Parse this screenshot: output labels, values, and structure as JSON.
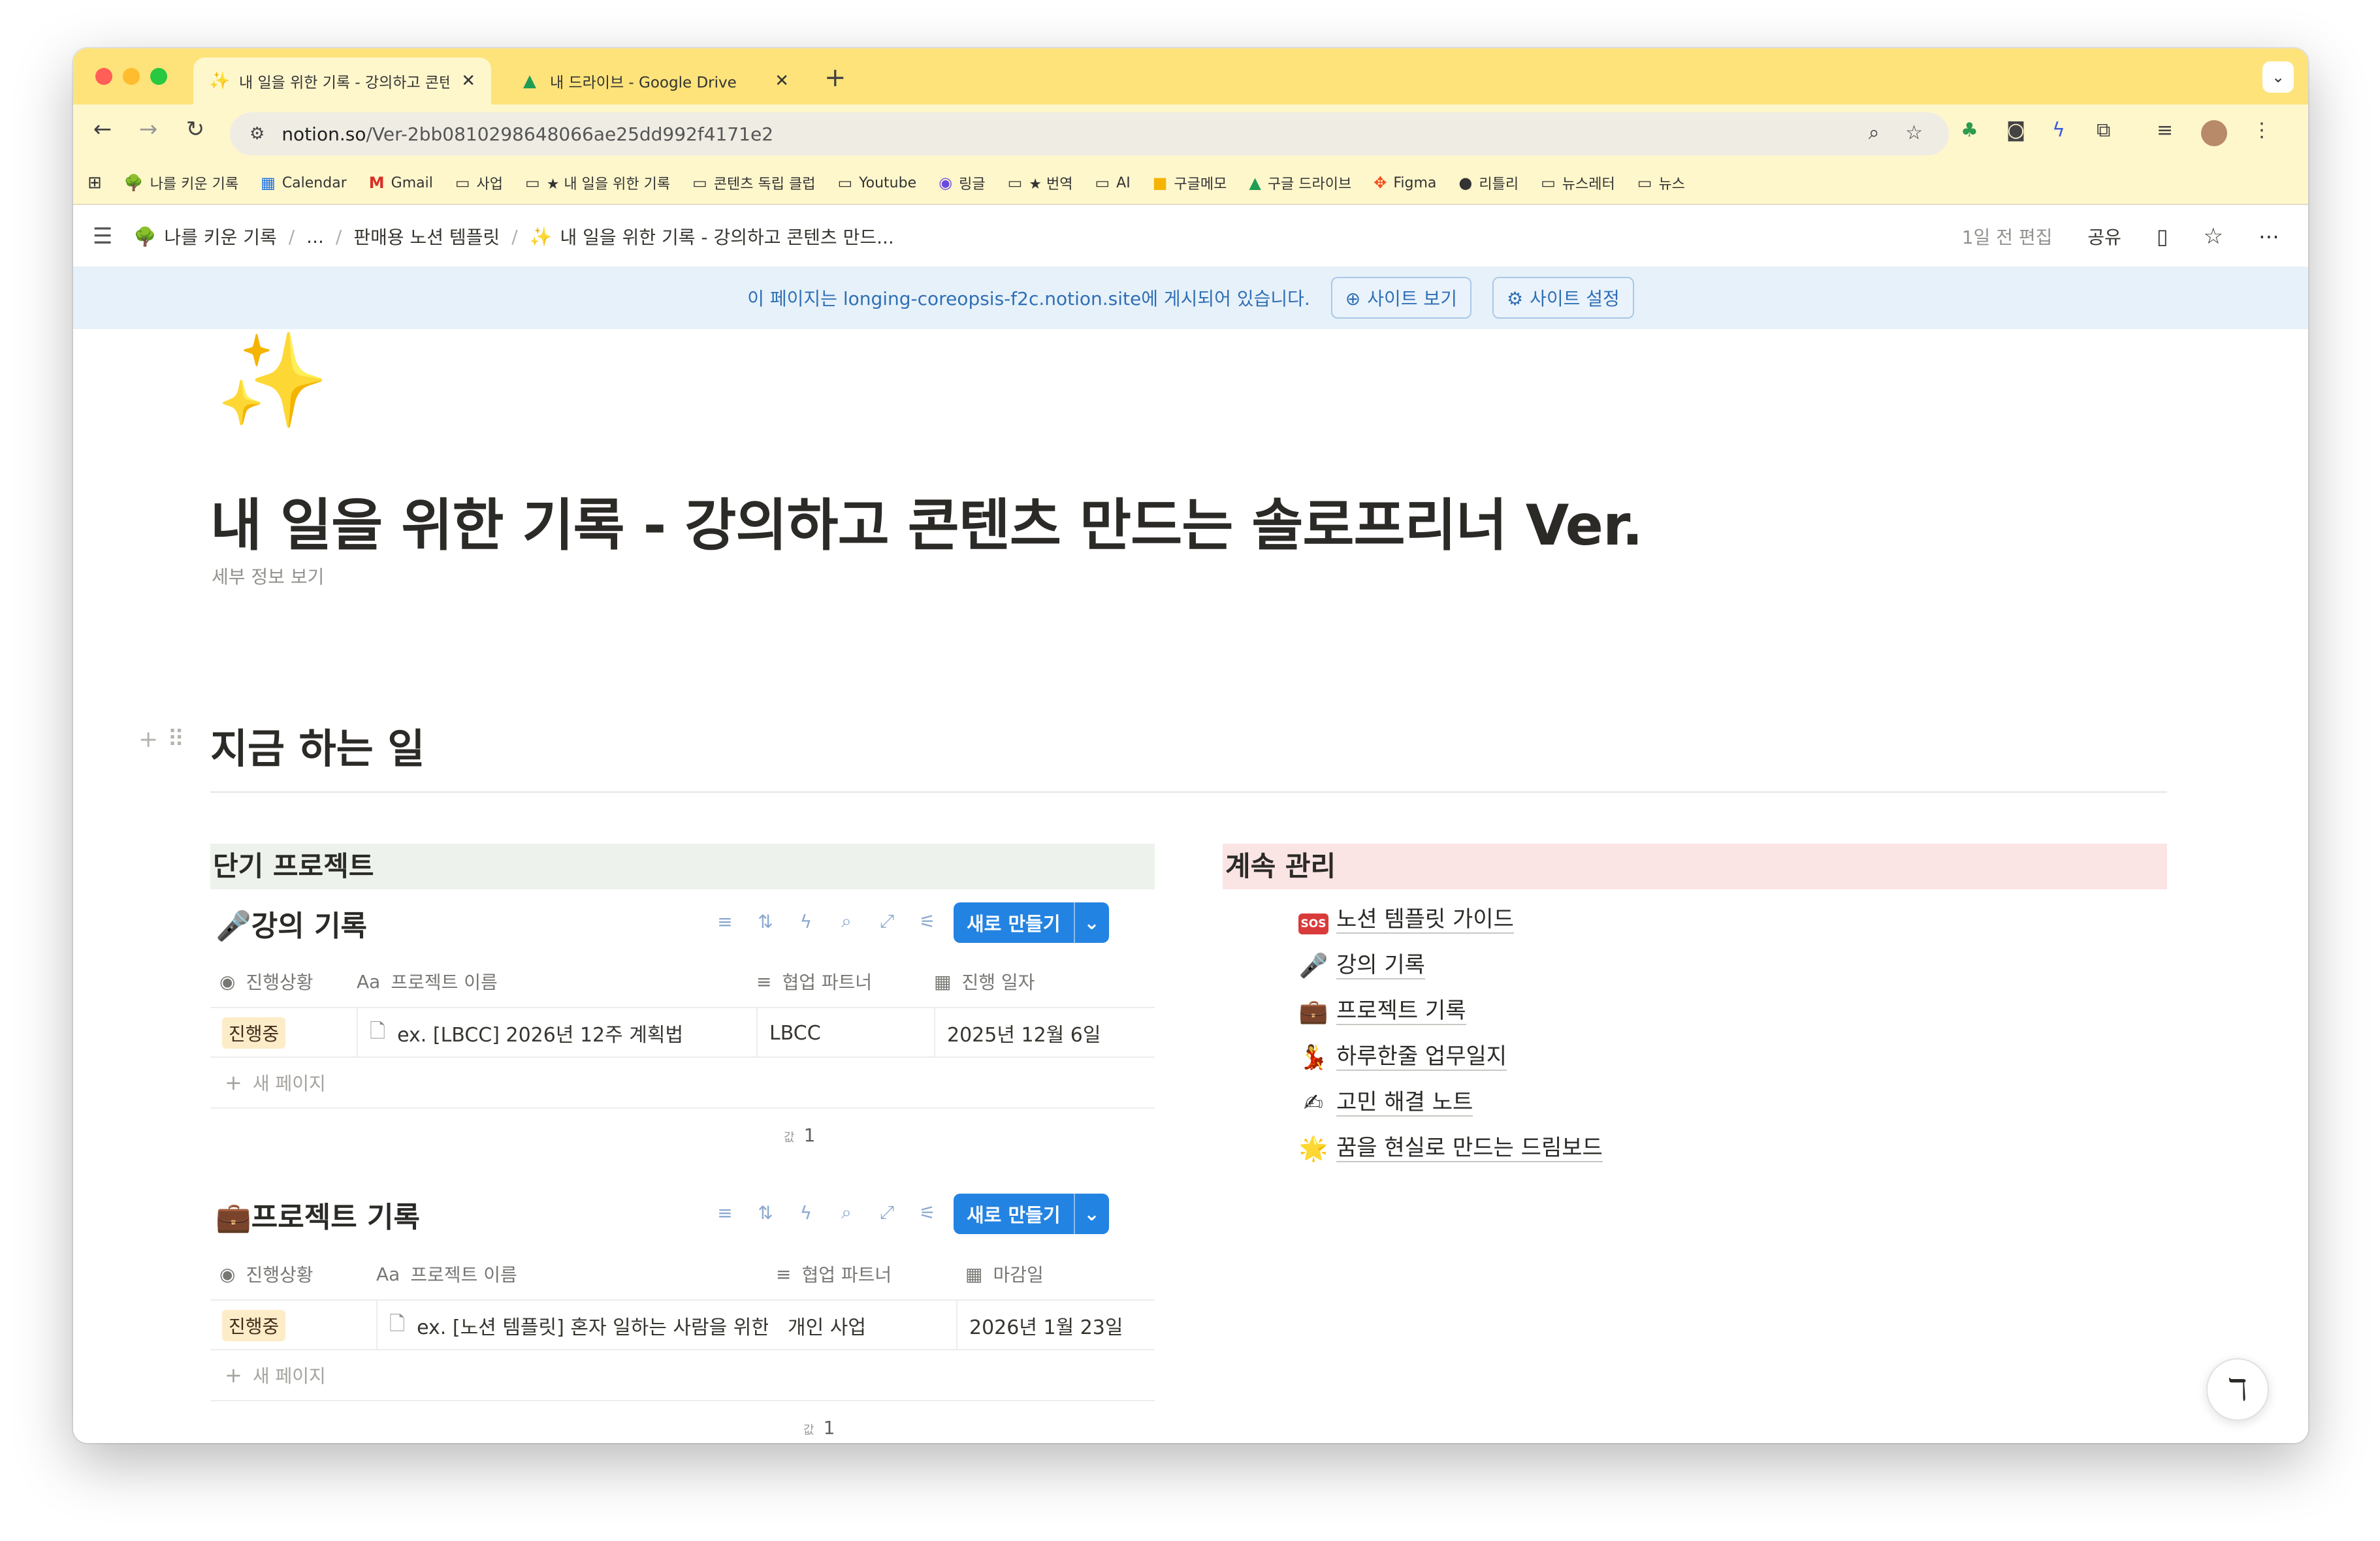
{
  "browser": {
    "tabs": [
      {
        "title": "내 일을 위한 기록 - 강의하고 콘텐",
        "icon": "sparkle-icon"
      },
      {
        "title": "내 드라이브 - Google Drive",
        "icon": "google-drive-icon"
      }
    ],
    "url_domain": "notion.so",
    "url_path": "/Ver-2bb0810298648066ae25dd992f4171e2",
    "bookmarks": [
      {
        "label": "나를 키운 기록",
        "icon": "tree-icon"
      },
      {
        "label": "Calendar",
        "icon": "calendar-icon"
      },
      {
        "label": "Gmail",
        "icon": "gmail-icon"
      },
      {
        "label": "사업",
        "icon": "folder-icon"
      },
      {
        "label": "★ 내 일을 위한 기록",
        "icon": "folder-icon"
      },
      {
        "label": "콘텐츠 독립 클럽",
        "icon": "folder-icon"
      },
      {
        "label": "Youtube",
        "icon": "folder-icon"
      },
      {
        "label": "링글",
        "icon": "ringle-icon"
      },
      {
        "label": "★ 번역",
        "icon": "folder-icon"
      },
      {
        "label": "AI",
        "icon": "folder-icon"
      },
      {
        "label": "구글메모",
        "icon": "keep-icon"
      },
      {
        "label": "구글 드라이브",
        "icon": "google-drive-icon"
      },
      {
        "label": "Figma",
        "icon": "figma-icon"
      },
      {
        "label": "리틀리",
        "icon": "littly-icon"
      },
      {
        "label": "뉴스레터",
        "icon": "folder-icon"
      },
      {
        "label": "뉴스",
        "icon": "folder-icon"
      }
    ]
  },
  "notion_top": {
    "breadcrumbs": [
      "나를 키운 기록",
      "...",
      "판매용 노션 템플릿",
      "내 일을 위한 기록 - 강의하고 콘텐츠 만드..."
    ],
    "edited": "1일 전 편집",
    "share": "공유"
  },
  "banner": {
    "prefix": "이 페이지는 ",
    "site": "longing-coreopsis-f2c.notion.site",
    "suffix": "에 게시되어 있습니다.",
    "view_site": "사이트 보기",
    "site_settings": "사이트 설정"
  },
  "page": {
    "title": "내 일을 위한 기록 - 강의하고 콘텐츠 만드는 솔로프리너 Ver.",
    "detail_link": "세부 정보 보기",
    "section_heading": "지금 하는 일",
    "left_column_heading": "단기 프로젝트",
    "right_column_heading": "계속 관리"
  },
  "databases": [
    {
      "title": "강의 기록",
      "icon": "microphone-icon",
      "new_button": "새로 만들기",
      "columns": [
        "진행상황",
        "프로젝트 이름",
        "협업 파트너",
        "진행 일자"
      ],
      "rows": [
        {
          "status": "진행중",
          "name": "ex. [LBCC] 2026년 12주 계획법",
          "partner": "LBCC",
          "date": "2025년 12월 6일"
        }
      ],
      "new_page": "새 페이지",
      "count_label": "값",
      "count": "1"
    },
    {
      "title": "프로젝트 기록",
      "icon": "briefcase-icon",
      "new_button": "새로 만들기",
      "columns": [
        "진행상황",
        "프로젝트 이름",
        "협업 파트너",
        "마감일"
      ],
      "rows": [
        {
          "status": "진행중",
          "name": "ex. [노션 템플릿] 혼자 일하는 사람을 위한 노",
          "partner": "개인 사업",
          "date": "2026년 1월 23일"
        }
      ],
      "new_page": "새 페이지",
      "count_label": "값",
      "count": "1"
    }
  ],
  "links": [
    {
      "label": "노션 템플릿 가이드",
      "icon": "sos-icon",
      "badge": "SOS"
    },
    {
      "label": "강의 기록",
      "icon": "microphone-icon"
    },
    {
      "label": "프로젝트 기록",
      "icon": "briefcase-icon"
    },
    {
      "label": "하루한줄 업무일지",
      "icon": "dancer-icon"
    },
    {
      "label": "고민 해결 노트",
      "icon": "writing-hand-icon"
    },
    {
      "label": "꿈을 현실로 만드는 드림보드",
      "icon": "glowing-star-icon"
    }
  ],
  "colors": {
    "tab_bar": "#fde37a",
    "toolbar": "#fff7cc",
    "banner_bg": "#e7f1f9",
    "accent_blue": "#2383e2",
    "left_heading_bg": "#edf3ec",
    "right_heading_bg": "#fbe4e4",
    "status_bg": "#fdecc8"
  }
}
